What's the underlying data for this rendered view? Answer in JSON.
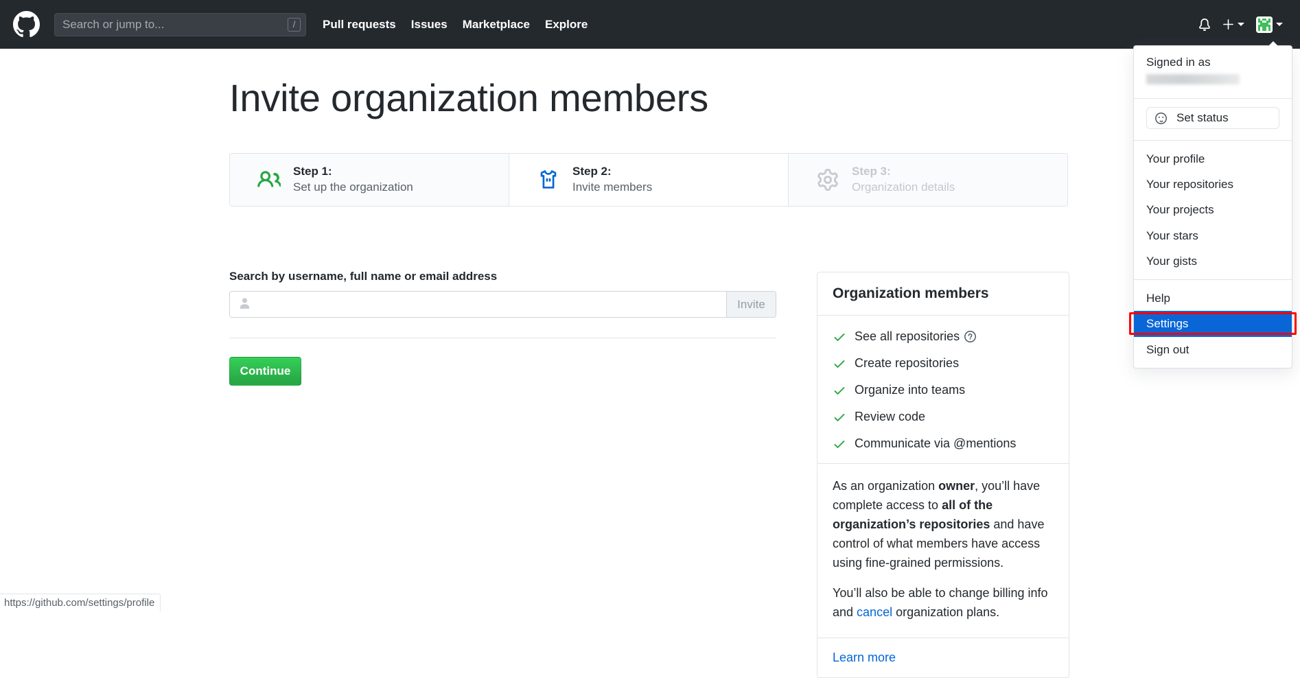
{
  "header": {
    "logo_icon": "github-mark-icon",
    "search": {
      "placeholder": "Search or jump to...",
      "value": "",
      "shortcut_badge": "/"
    },
    "nav": [
      {
        "label": "Pull requests"
      },
      {
        "label": "Issues"
      },
      {
        "label": "Marketplace"
      },
      {
        "label": "Explore"
      }
    ],
    "notifications_icon": "bell-icon",
    "create_new_icon": "plus-icon",
    "avatar_icon": "identicon-avatar"
  },
  "page": {
    "title": "Invite organization members"
  },
  "steps": [
    {
      "icon": "people-icon",
      "number": "Step 1:",
      "desc": "Set up the organization",
      "state": "done"
    },
    {
      "icon": "jersey-icon",
      "number": "Step 2:",
      "desc": "Invite members",
      "state": "active"
    },
    {
      "icon": "gear-icon",
      "number": "Step 3:",
      "desc": "Organization details",
      "state": "disabled"
    }
  ],
  "form": {
    "label": "Search by username, full name or email address",
    "input_placeholder": "",
    "input_value": "",
    "person_icon": "person-icon",
    "invite_label": "Invite",
    "continue_label": "Continue"
  },
  "info_panel": {
    "heading": "Organization members",
    "capabilities": [
      {
        "text": "See all repositories",
        "help_icon": "question-icon"
      },
      {
        "text": "Create repositories",
        "help_icon": ""
      },
      {
        "text": "Organize into teams",
        "help_icon": ""
      },
      {
        "text": "Review code",
        "help_icon": ""
      },
      {
        "text": "Communicate via @mentions",
        "help_icon": ""
      }
    ],
    "body_p1_a": "As an organization ",
    "body_p1_b": "owner",
    "body_p1_c": ", you’ll have complete access to ",
    "body_p1_d": "all of the organization’s repositories",
    "body_p1_e": " and have control of what members have access using fine-grained permissions.",
    "body_p2_a": "You’ll also be able to change billing info and ",
    "body_p2_link": "cancel",
    "body_p2_b": " organization plans.",
    "learn_more": "Learn more"
  },
  "dropdown": {
    "signed_in_label": "Signed in as",
    "username_redacted": "",
    "set_status_label": "Set status",
    "smiley_icon": "smiley-icon",
    "items_group1": [
      {
        "label": "Your profile"
      },
      {
        "label": "Your repositories"
      },
      {
        "label": "Your projects"
      },
      {
        "label": "Your stars"
      },
      {
        "label": "Your gists"
      }
    ],
    "items_group2": [
      {
        "label": "Help",
        "selected": false
      },
      {
        "label": "Settings",
        "selected": true
      },
      {
        "label": "Sign out",
        "selected": false
      }
    ]
  },
  "statusbar": {
    "url": "https://github.com/settings/profile"
  },
  "colors": {
    "header_bg": "#24292e",
    "green": "#28a745",
    "blue": "#0366d6",
    "selection_blue": "#0a66d6",
    "annotation_red": "#ff0000",
    "border": "#e1e4e8",
    "muted": "#586069"
  }
}
